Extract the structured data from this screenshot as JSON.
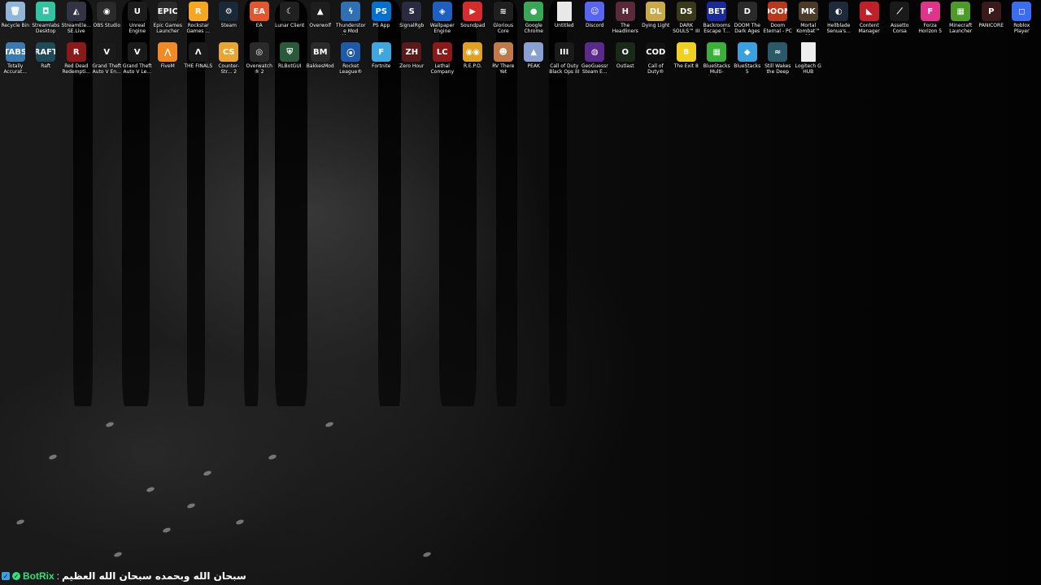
{
  "desktop": {
    "row1": [
      {
        "label": "Recycle Bin",
        "icon": "recycle-bin-icon",
        "color": "#8fb6d9",
        "glyph": "🗑"
      },
      {
        "label": "Streamlabs Desktop",
        "icon": "streamlabs-icon",
        "color": "#31c3a2",
        "glyph": "◘"
      },
      {
        "label": "StreamEle... SE.Live",
        "icon": "streamelements-icon",
        "color": "#333344",
        "glyph": "◭"
      },
      {
        "label": "OBS Studio",
        "icon": "obs-icon",
        "color": "#2a2a2a",
        "glyph": "◉"
      },
      {
        "label": "Unreal Engine",
        "icon": "unreal-engine-icon",
        "color": "#1c1c1c",
        "glyph": "U"
      },
      {
        "label": "Epic Games Launcher",
        "icon": "epic-games-icon",
        "color": "#2b2b2b",
        "glyph": "EPIC"
      },
      {
        "label": "Rockstar Games ...",
        "icon": "rockstar-icon",
        "color": "#f5a623",
        "glyph": "R"
      },
      {
        "label": "Steam",
        "icon": "steam-icon",
        "color": "#1b2838",
        "glyph": "⚙"
      },
      {
        "label": "EA",
        "icon": "ea-icon",
        "color": "#e4572e",
        "glyph": "EA"
      },
      {
        "label": "Lunar Client",
        "icon": "lunar-client-icon",
        "color": "#202020",
        "glyph": "☾"
      },
      {
        "label": "Overwolf",
        "icon": "overwolf-icon",
        "color": "#1e1e1e",
        "glyph": "▲"
      },
      {
        "label": "Thunderstore Mod Mana...",
        "icon": "thunderstore-icon",
        "color": "#2f6fb3",
        "glyph": "ϟ"
      },
      {
        "label": "PS App",
        "icon": "ps-app-icon",
        "color": "#0070d1",
        "glyph": "PS"
      },
      {
        "label": "SignalRgb",
        "icon": "signalrgb-icon",
        "color": "#2a2a40",
        "glyph": "S"
      },
      {
        "label": "Wallpaper Engine",
        "icon": "wallpaper-engine-icon",
        "color": "#1e5fbf",
        "glyph": "◈"
      },
      {
        "label": "Soundpad",
        "icon": "soundpad-icon",
        "color": "#d62b2b",
        "glyph": "▶"
      },
      {
        "label": "Glorious Core",
        "icon": "glorious-core-icon",
        "color": "#1f1f1f",
        "glyph": "≋"
      },
      {
        "label": "Google Chrome",
        "icon": "chrome-icon",
        "color": "#3aa757",
        "glyph": "●"
      },
      {
        "label": "Untitled",
        "icon": "document-icon",
        "color": "#e8e8e8",
        "glyph": ""
      },
      {
        "label": "Discord",
        "icon": "discord-icon",
        "color": "#5865f2",
        "glyph": "☺"
      },
      {
        "label": "The Headliners",
        "icon": "headliners-icon",
        "color": "#5a2a3a",
        "glyph": "H"
      },
      {
        "label": "Dying Light",
        "icon": "dying-light-icon",
        "color": "#c9a94a",
        "glyph": "DL"
      },
      {
        "label": "DARK SOULS™ III",
        "icon": "dark-souls-icon",
        "color": "#3a3a1a",
        "glyph": "DS"
      },
      {
        "label": "Backrooms Escape T...",
        "icon": "backrooms-icon",
        "color": "#1a2a9a",
        "glyph": "BET"
      },
      {
        "label": "DOOM The Dark Ages",
        "icon": "doom-dark-ages-icon",
        "color": "#2a2a2a",
        "glyph": "D"
      },
      {
        "label": "Doom Eternal - PC",
        "icon": "doom-eternal-icon",
        "color": "#b8381e",
        "glyph": "DOOM"
      },
      {
        "label": "Mortal Kombat™ 11",
        "icon": "mortal-kombat-icon",
        "color": "#4a3a2a",
        "glyph": "MK"
      },
      {
        "label": "Hellblade Senua's...",
        "icon": "hellblade-icon",
        "color": "#1e2a3a",
        "glyph": "◐"
      },
      {
        "label": "Content Manager",
        "icon": "content-manager-icon",
        "color": "#c0202a",
        "glyph": "◣"
      },
      {
        "label": "Assetto Corsa",
        "icon": "assetto-corsa-icon",
        "color": "#1a1a1a",
        "glyph": "⟋"
      },
      {
        "label": "Forza Horizon 5",
        "icon": "forza-icon",
        "color": "#e0348a",
        "glyph": "F"
      },
      {
        "label": "Minecraft Launcher",
        "icon": "minecraft-icon",
        "color": "#4c9a2a",
        "glyph": "▦"
      },
      {
        "label": "PANICORE",
        "icon": "panicore-icon",
        "color": "#3a1a1a",
        "glyph": "P"
      },
      {
        "label": "Roblox Player",
        "icon": "roblox-icon",
        "color": "#3a6df0",
        "glyph": "◻"
      }
    ],
    "row2": [
      {
        "label": "Totally Accurat...",
        "icon": "tabs-icon",
        "color": "#3a7ab0",
        "glyph": "TABS"
      },
      {
        "label": "Raft",
        "icon": "raft-icon",
        "color": "#1f4a5a",
        "glyph": "RAFT"
      },
      {
        "label": "Red Dead Redempti...",
        "icon": "red-dead-icon",
        "color": "#8a1a1a",
        "glyph": "R"
      },
      {
        "label": "Grand Theft Auto V En...",
        "icon": "gta-v-enhanced-icon",
        "color": "#1a1a1a",
        "glyph": "V"
      },
      {
        "label": "Grand Theft Auto V Le...",
        "icon": "gta-v-legacy-icon",
        "color": "#1a1a1a",
        "glyph": "V"
      },
      {
        "label": "FiveM",
        "icon": "fivem-icon",
        "color": "#f08a24",
        "glyph": "⋀"
      },
      {
        "label": "THE FINALS",
        "icon": "the-finals-icon",
        "color": "#1a1a1a",
        "glyph": "Λ"
      },
      {
        "label": "Counter-Str... 2",
        "icon": "counter-strike-icon",
        "color": "#e8a530",
        "glyph": "CS"
      },
      {
        "label": "Overwatch® 2",
        "icon": "overwatch-icon",
        "color": "#2a2a2a",
        "glyph": "◎"
      },
      {
        "label": "RLBotGUI",
        "icon": "rlbot-icon",
        "color": "#2a5a3a",
        "glyph": "⛨"
      },
      {
        "label": "BakkesMod",
        "icon": "bakkesmod-icon",
        "color": "#2a2a2a",
        "glyph": "BM"
      },
      {
        "label": "Rocket League®",
        "icon": "rocket-league-icon",
        "color": "#1f5aa8",
        "glyph": "⦿"
      },
      {
        "label": "Fortnite",
        "icon": "fortnite-icon",
        "color": "#3fa7e0",
        "glyph": "F"
      },
      {
        "label": "Zero Hour",
        "icon": "zero-hour-icon",
        "color": "#5a1a1a",
        "glyph": "ZH"
      },
      {
        "label": "Lethal Company",
        "icon": "lethal-company-icon",
        "color": "#8a1a1a",
        "glyph": "LC"
      },
      {
        "label": "R.E.P.O.",
        "icon": "repo-icon",
        "color": "#e0a020",
        "glyph": "◉◉"
      },
      {
        "label": "RV There Yet",
        "icon": "rv-there-yet-icon",
        "color": "#c07a4a",
        "glyph": "☻"
      },
      {
        "label": "PEAK",
        "icon": "peak-icon",
        "color": "#8aa0d0",
        "glyph": "▲"
      },
      {
        "label": "Call of Duty Black Ops III",
        "icon": "black-ops-3-icon",
        "color": "#1a1a1a",
        "glyph": "III"
      },
      {
        "label": "GeoGuessr Steam E...",
        "icon": "geoguessr-icon",
        "color": "#5a2a8a",
        "glyph": "◍"
      },
      {
        "label": "Outlast",
        "icon": "outlast-icon",
        "color": "#1a2a1a",
        "glyph": "O"
      },
      {
        "label": "Call of Duty®",
        "icon": "call-of-duty-icon",
        "color": "#111111",
        "glyph": "COD"
      },
      {
        "label": "The Exit 8",
        "icon": "exit-8-icon",
        "color": "#f0d020",
        "glyph": "8"
      },
      {
        "label": "BlueStacks Multi-Insta...",
        "icon": "bluestacks-multi-icon",
        "color": "#3ab03a",
        "glyph": "▦"
      },
      {
        "label": "BlueStacks 5",
        "icon": "bluestacks-icon",
        "color": "#3aa0e0",
        "glyph": "◆"
      },
      {
        "label": "Still Wakes the Deep",
        "icon": "still-wakes-icon",
        "color": "#2a5a6a",
        "glyph": "≈"
      },
      {
        "label": "Logitech G HUB",
        "icon": "logitech-ghub-icon",
        "color": "#eeeeee",
        "glyph": ""
      }
    ]
  },
  "chat": {
    "name": "BotRix",
    "separator": ":",
    "message": "سبحان الله وبحمده سبحان الله العظيم"
  }
}
